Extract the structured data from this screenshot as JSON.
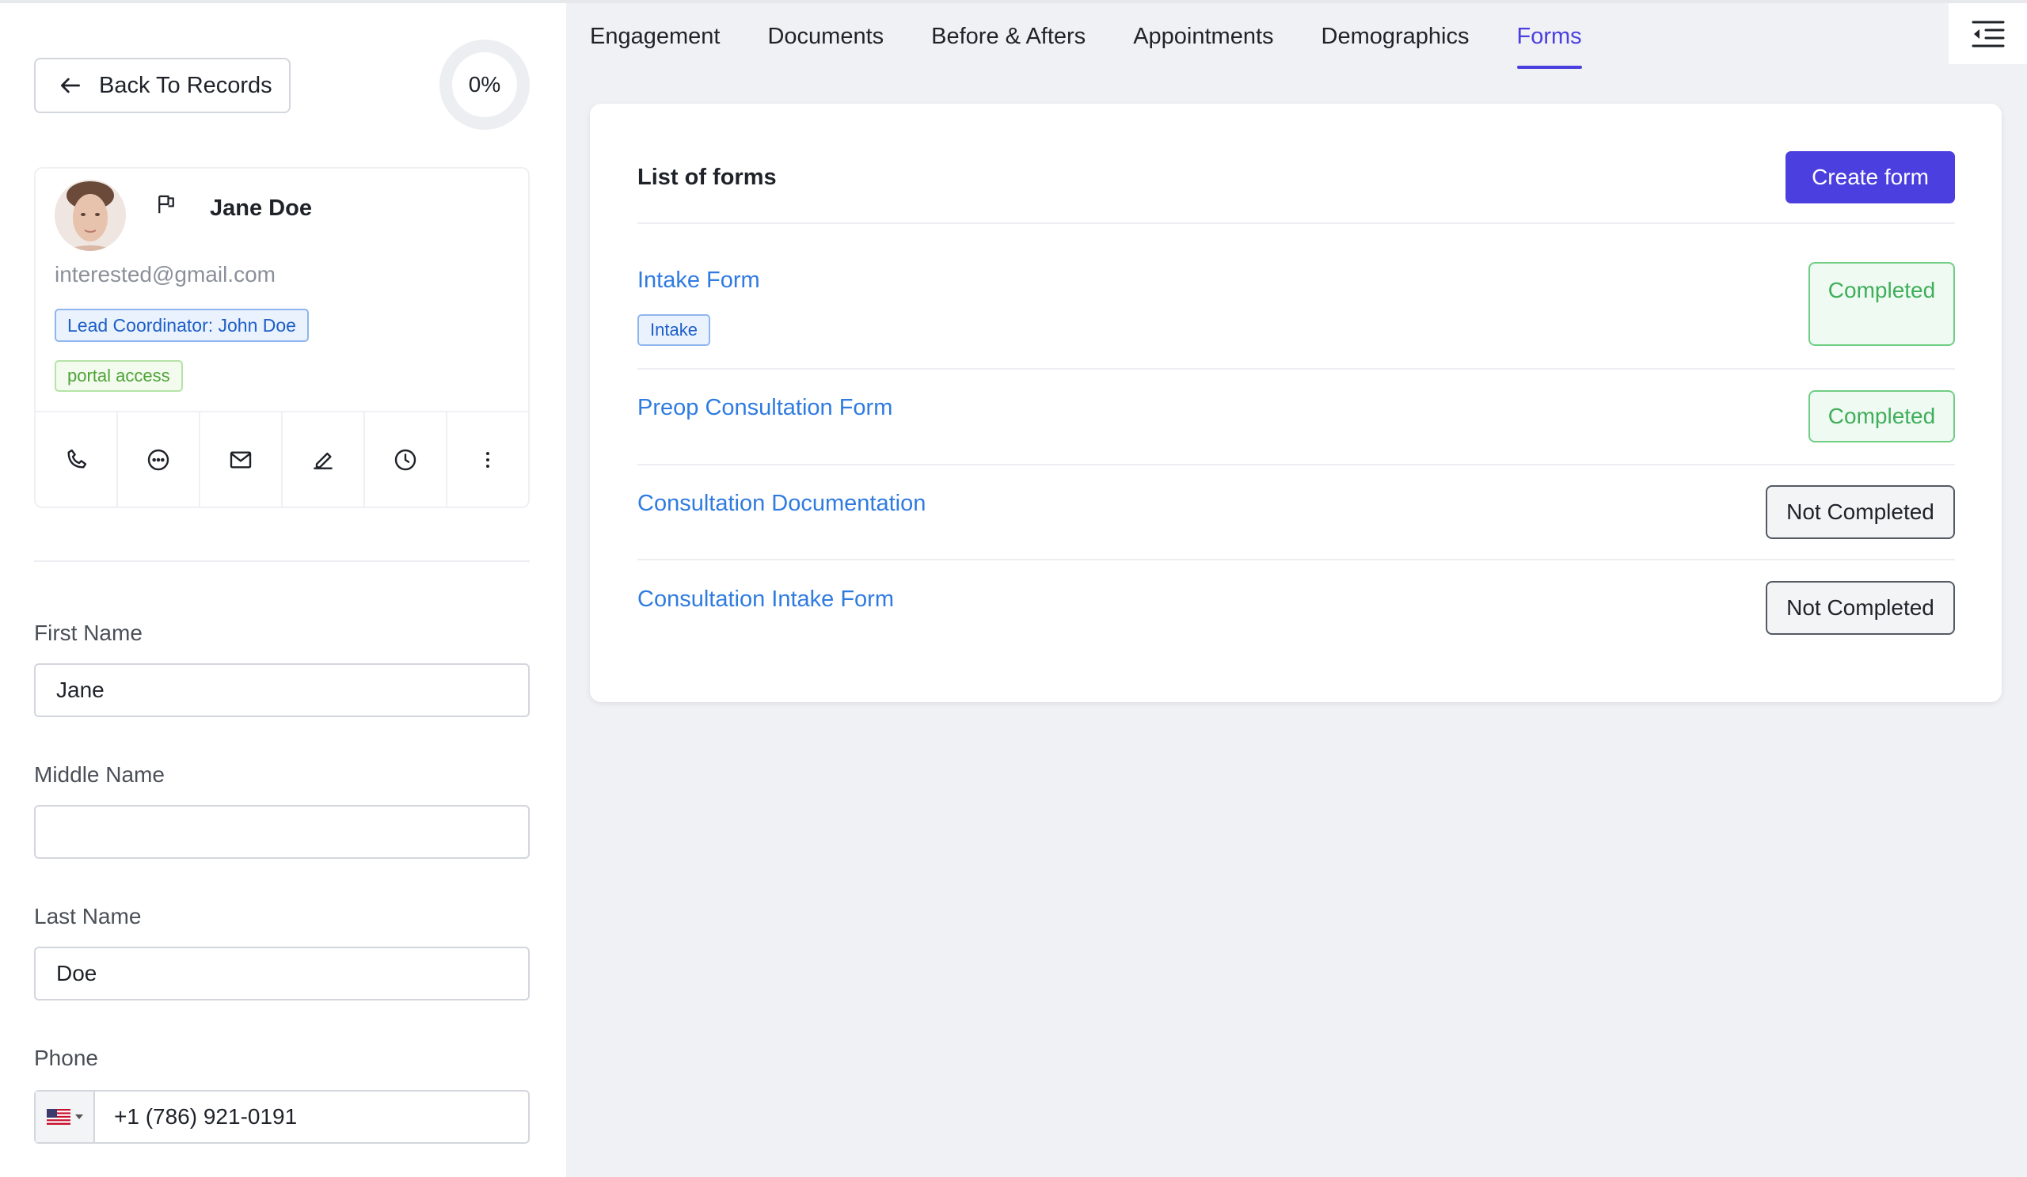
{
  "colors": {
    "accent": "#4b3fe0",
    "link": "#2f7be0",
    "completed": "#3fae5a",
    "background": "#f0f1f5"
  },
  "header": {
    "back_label": "Back To Records",
    "progress": "0%"
  },
  "contact": {
    "name": "Jane Doe",
    "email": "interested@gmail.com",
    "coordinator_tag": "Lead Coordinator: John Doe",
    "portal_tag": "portal access",
    "actions": [
      "phone-icon",
      "chat-icon",
      "mail-icon",
      "edit-icon",
      "clock-icon",
      "more-vertical-icon"
    ]
  },
  "fields": {
    "first_name": {
      "label": "First Name",
      "value": "Jane"
    },
    "middle_name": {
      "label": "Middle Name",
      "value": ""
    },
    "last_name": {
      "label": "Last Name",
      "value": "Doe"
    },
    "phone": {
      "label": "Phone",
      "value": "+1 (786) 921-0191",
      "country": "us-flag-icon"
    }
  },
  "tabs": [
    "Engagement",
    "Documents",
    "Before & Afters",
    "Appointments",
    "Demographics",
    "Forms"
  ],
  "active_tab": "Forms",
  "forms": {
    "title": "List of forms",
    "create_label": "Create form",
    "items": [
      {
        "name": "Intake Form",
        "tag": "Intake",
        "status": "Completed"
      },
      {
        "name": "Preop Consultation Form",
        "status": "Completed"
      },
      {
        "name": "Consultation Documentation",
        "status": "Not Completed"
      },
      {
        "name": "Consultation Intake Form",
        "status": "Not Completed"
      }
    ]
  }
}
